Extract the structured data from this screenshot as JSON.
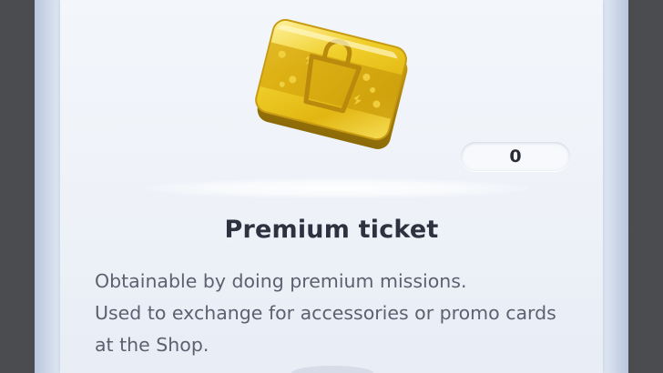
{
  "item": {
    "name": "Premium ticket",
    "count": "0",
    "icon": "premium-ticket-icon",
    "description_lines": [
      "Obtainable by doing premium missions.",
      "Used to exchange for accessories or promo cards",
      "at the Shop."
    ]
  },
  "colors": {
    "background": "#4a4c50",
    "panel": "#eef2f8",
    "title_text": "#2f3140",
    "body_text": "#5c6170",
    "ticket_gold": "#e8c21a"
  }
}
